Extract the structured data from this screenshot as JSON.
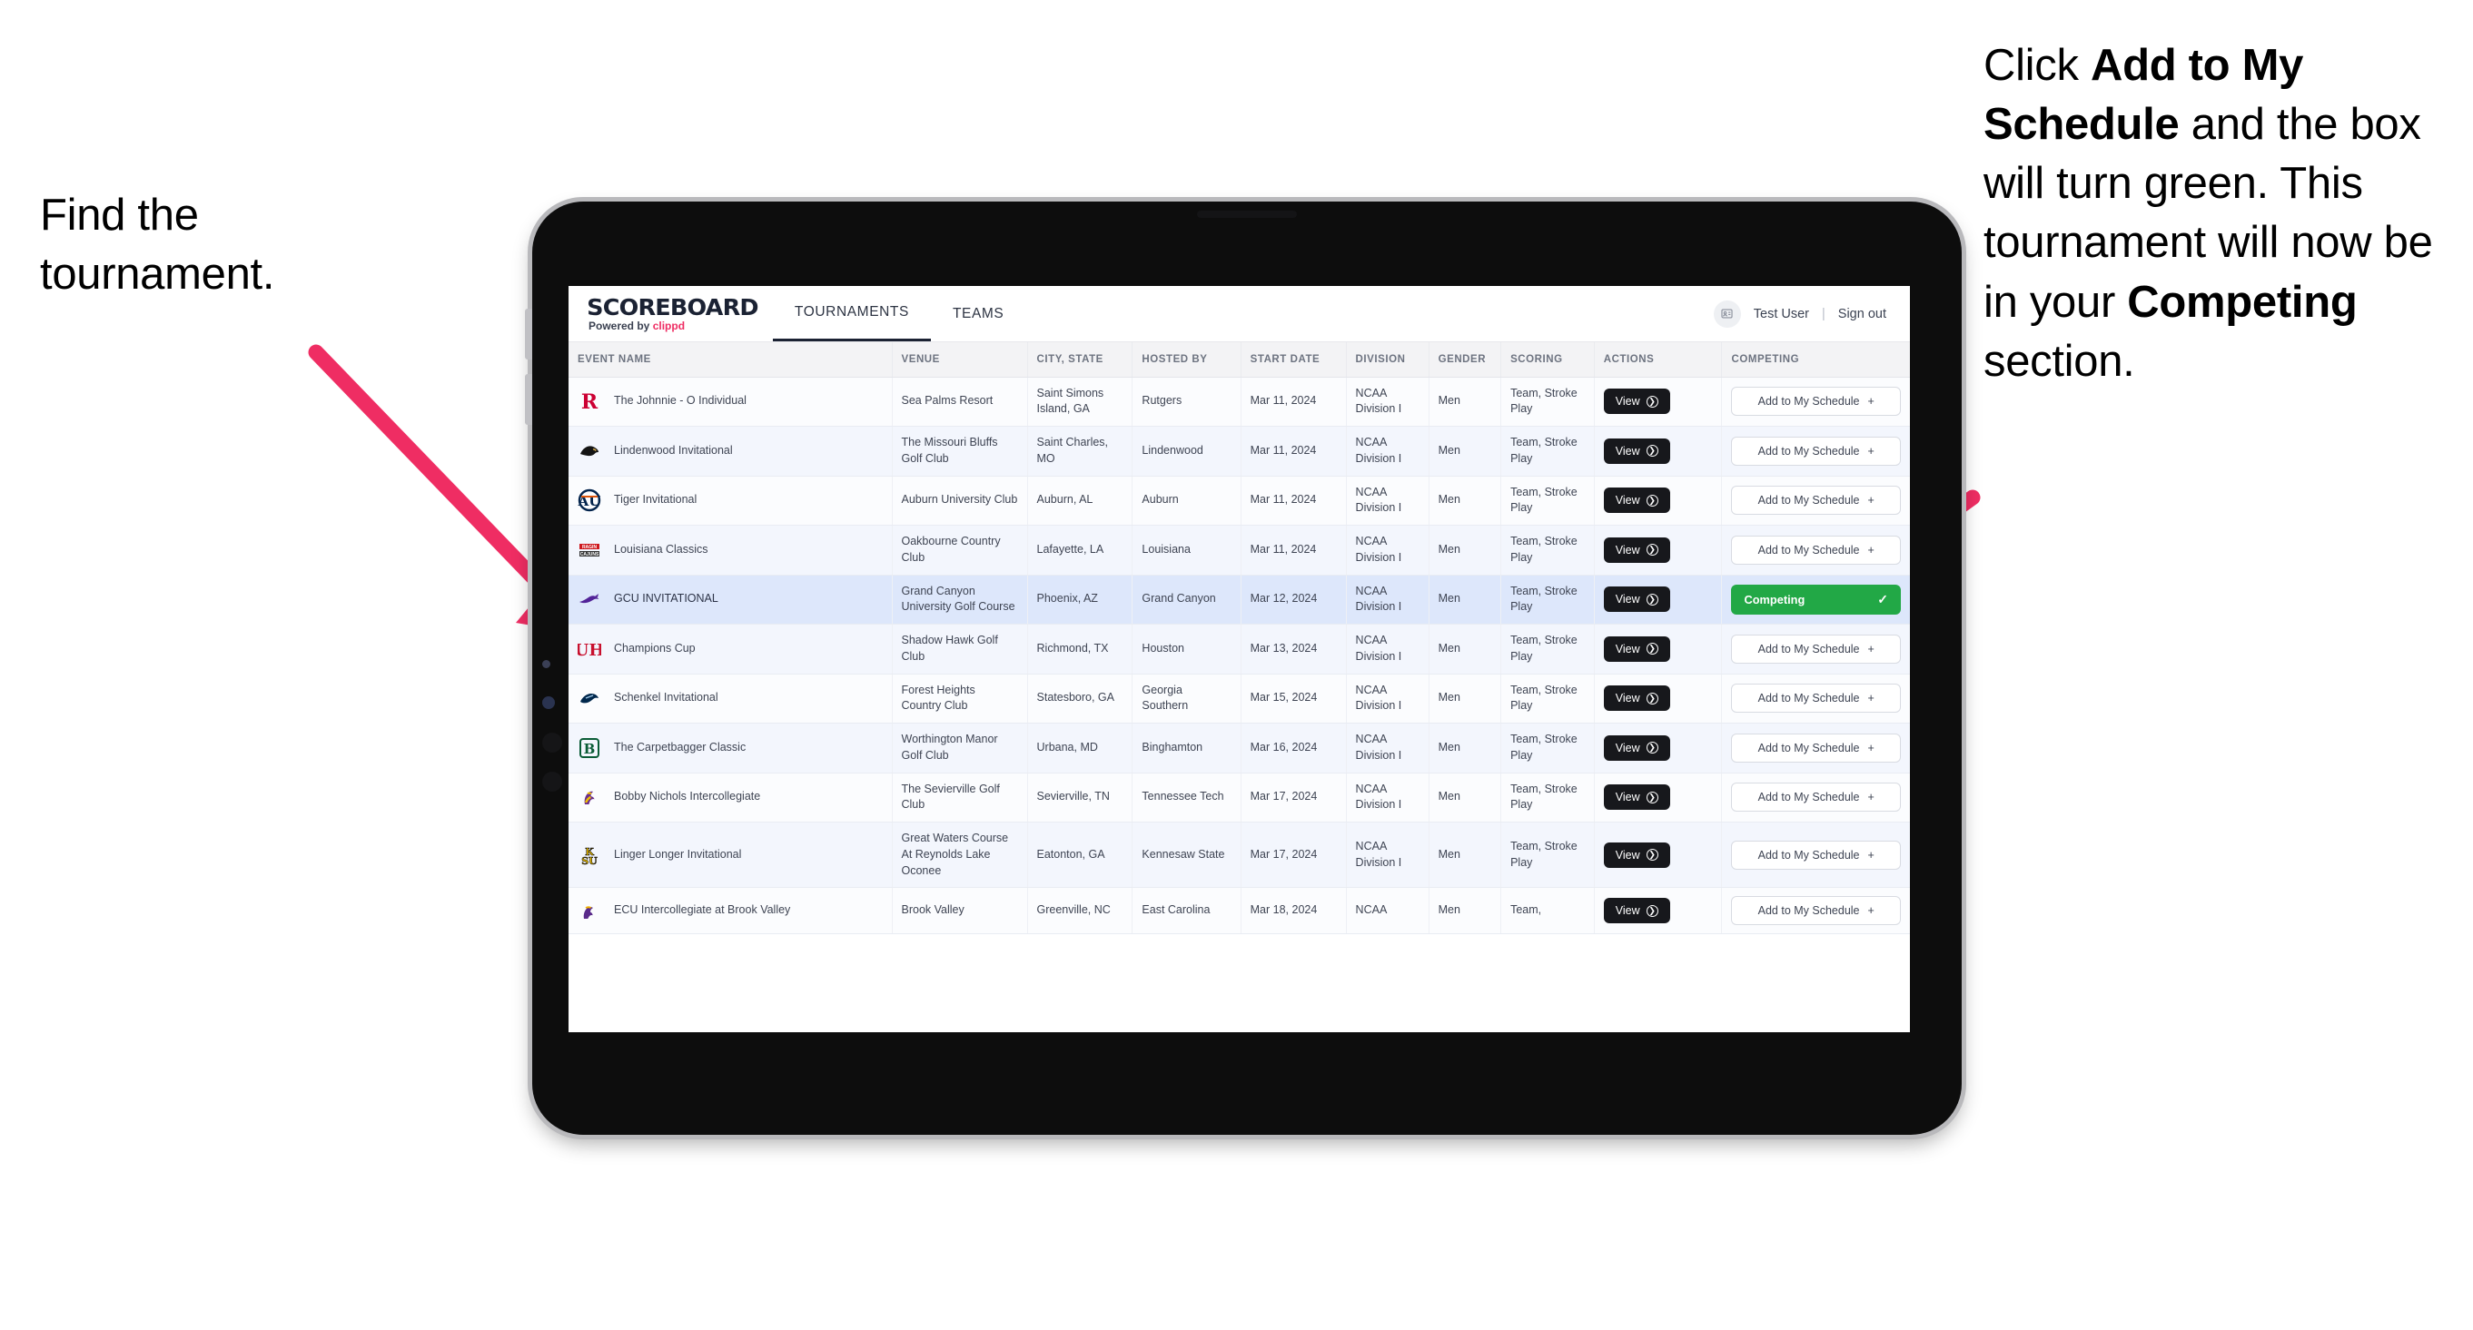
{
  "annotations": {
    "left": "Find the tournament.",
    "right_parts": [
      {
        "text": "Click ",
        "bold": false
      },
      {
        "text": "Add to My Schedule",
        "bold": true
      },
      {
        "text": " and the box will turn green. This tournament will now be in your ",
        "bold": false
      },
      {
        "text": "Competing",
        "bold": true
      },
      {
        "text": " section.",
        "bold": false
      }
    ],
    "arrow_color": "#ef2d63"
  },
  "app": {
    "brand": {
      "name": "SCOREBOARD",
      "powered_prefix": "Powered by ",
      "powered_brand": "clippd"
    },
    "tabs": [
      {
        "label": "TOURNAMENTS",
        "active": true
      },
      {
        "label": "TEAMS",
        "active": false
      }
    ],
    "user": {
      "avatar_icon": "user-card-icon",
      "name": "Test User",
      "divider": "|",
      "signout": "Sign out"
    },
    "table": {
      "headers": [
        "EVENT NAME",
        "VENUE",
        "CITY, STATE",
        "HOSTED BY",
        "START DATE",
        "DIVISION",
        "GENDER",
        "SCORING",
        "ACTIONS",
        "COMPETING"
      ],
      "action_label": "View",
      "add_label": "Add to My Schedule",
      "add_icon": "plus-icon",
      "competing_label": "Competing",
      "competing_icon": "check-icon",
      "competing_color": "#22a846",
      "rows": [
        {
          "logo": "rutgers-r-logo",
          "event": "The Johnnie - O Individual",
          "venue": "Sea Palms Resort",
          "city": "Saint Simons Island, GA",
          "host": "Rutgers",
          "date": "Mar 11, 2024",
          "division": "NCAA Division I",
          "gender": "Men",
          "scoring": "Team, Stroke Play",
          "competing": false
        },
        {
          "logo": "lindenwood-lion-logo",
          "event": "Lindenwood Invitational",
          "venue": "The Missouri Bluffs Golf Club",
          "city": "Saint Charles, MO",
          "host": "Lindenwood",
          "date": "Mar 11, 2024",
          "division": "NCAA Division I",
          "gender": "Men",
          "scoring": "Team, Stroke Play",
          "competing": false
        },
        {
          "logo": "auburn-au-logo",
          "event": "Tiger Invitational",
          "venue": "Auburn University Club",
          "city": "Auburn, AL",
          "host": "Auburn",
          "date": "Mar 11, 2024",
          "division": "NCAA Division I",
          "gender": "Men",
          "scoring": "Team, Stroke Play",
          "competing": false
        },
        {
          "logo": "louisiana-ragin-cajuns-logo",
          "event": "Louisiana Classics",
          "venue": "Oakbourne Country Club",
          "city": "Lafayette, LA",
          "host": "Louisiana",
          "date": "Mar 11, 2024",
          "division": "NCAA Division I",
          "gender": "Men",
          "scoring": "Team, Stroke Play",
          "competing": false
        },
        {
          "logo": "grand-canyon-lope-logo",
          "event": "GCU INVITATIONAL",
          "venue": "Grand Canyon University Golf Course",
          "city": "Phoenix, AZ",
          "host": "Grand Canyon",
          "date": "Mar 12, 2024",
          "division": "NCAA Division I",
          "gender": "Men",
          "scoring": "Team, Stroke Play",
          "competing": true
        },
        {
          "logo": "houston-uh-logo",
          "event": "Champions Cup",
          "venue": "Shadow Hawk Golf Club",
          "city": "Richmond, TX",
          "host": "Houston",
          "date": "Mar 13, 2024",
          "division": "NCAA Division I",
          "gender": "Men",
          "scoring": "Team, Stroke Play",
          "competing": false
        },
        {
          "logo": "georgia-southern-eagle-logo",
          "event": "Schenkel Invitational",
          "venue": "Forest Heights Country Club",
          "city": "Statesboro, GA",
          "host": "Georgia Southern",
          "date": "Mar 15, 2024",
          "division": "NCAA Division I",
          "gender": "Men",
          "scoring": "Team, Stroke Play",
          "competing": false
        },
        {
          "logo": "binghamton-b-logo",
          "event": "The Carpetbagger Classic",
          "venue": "Worthington Manor Golf Club",
          "city": "Urbana, MD",
          "host": "Binghamton",
          "date": "Mar 16, 2024",
          "division": "NCAA Division I",
          "gender": "Men",
          "scoring": "Team, Stroke Play",
          "competing": false
        },
        {
          "logo": "tennessee-tech-eagle-logo",
          "event": "Bobby Nichols Intercollegiate",
          "venue": "The Sevierville Golf Club",
          "city": "Sevierville, TN",
          "host": "Tennessee Tech",
          "date": "Mar 17, 2024",
          "division": "NCAA Division I",
          "gender": "Men",
          "scoring": "Team, Stroke Play",
          "competing": false
        },
        {
          "logo": "kennesaw-state-ksu-logo",
          "event": "Linger Longer Invitational",
          "venue": "Great Waters Course At Reynolds Lake Oconee",
          "city": "Eatonton, GA",
          "host": "Kennesaw State",
          "date": "Mar 17, 2024",
          "division": "NCAA Division I",
          "gender": "Men",
          "scoring": "Team, Stroke Play",
          "competing": false
        },
        {
          "logo": "east-carolina-pirate-logo",
          "event": "ECU Intercollegiate at Brook Valley",
          "venue": "Brook Valley",
          "city": "Greenville, NC",
          "host": "East Carolina",
          "date": "Mar 18, 2024",
          "division": "NCAA",
          "gender": "Men",
          "scoring": "Team,",
          "competing": false
        }
      ]
    }
  }
}
